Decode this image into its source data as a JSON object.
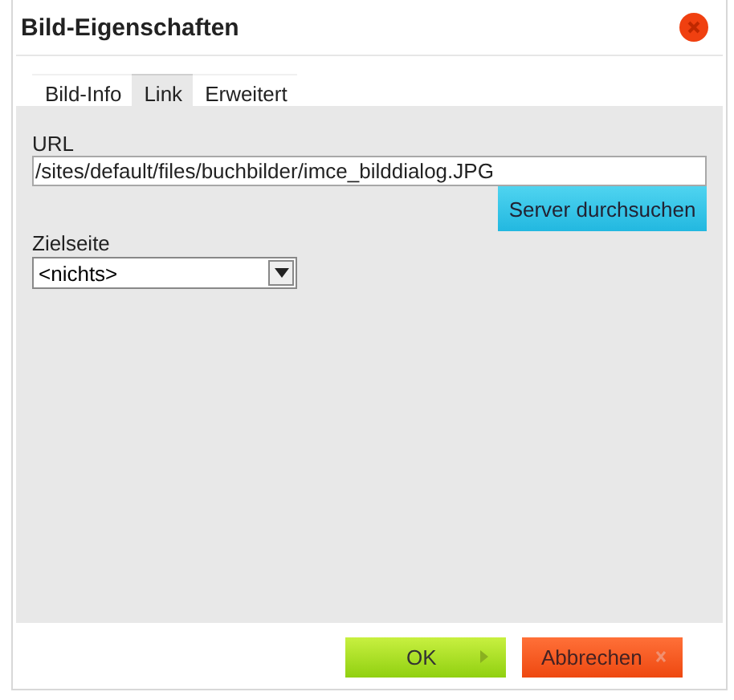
{
  "window": {
    "title": "Bild-Eigenschaften"
  },
  "tabs": [
    {
      "label": "Bild-Info",
      "selected": false
    },
    {
      "label": "Link",
      "selected": true
    },
    {
      "label": "Erweitert",
      "selected": false
    }
  ],
  "url": {
    "label": "URL",
    "value": "/sites/default/files/buchbilder/imce_bilddialog.JPG"
  },
  "browse_button": "Server durchsuchen",
  "target": {
    "label": "Zielseite",
    "value": "<nichts>"
  },
  "buttons": [
    {
      "kind": "ok",
      "label": "OK"
    },
    {
      "kind": "cancel",
      "label": "Abbrechen"
    }
  ]
}
